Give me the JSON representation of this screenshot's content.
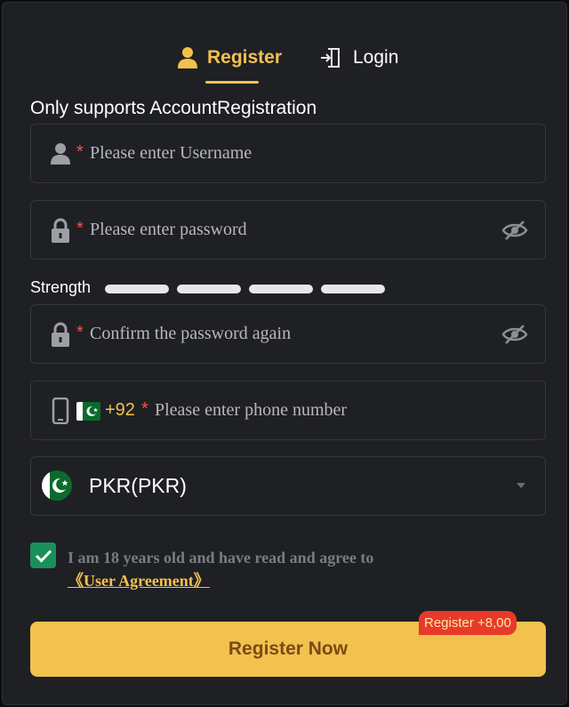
{
  "tabs": {
    "register": "Register",
    "login": "Login"
  },
  "subtitle": "Only supports AccountRegistration",
  "username": {
    "required": "*",
    "placeholder": "Please enter Username"
  },
  "password": {
    "required": "*",
    "placeholder": "Please enter password"
  },
  "strength": {
    "label": "Strength",
    "levels_filled": 0,
    "levels_total": 4
  },
  "confirm": {
    "required": "*",
    "placeholder": "Confirm the password again"
  },
  "phone": {
    "code": "+92",
    "required": "*",
    "placeholder": "Please enter phone number"
  },
  "currency": {
    "value": "PKR(PKR)"
  },
  "agreement": {
    "checked": true,
    "text": "I am 18 years old and have read and agree to ",
    "link": "《User Agreement》"
  },
  "submit": {
    "label": "Register Now",
    "bonus": "Register +8,00"
  },
  "icons": [
    "user-icon",
    "login-door-icon",
    "lock-icon",
    "eye-off-icon",
    "phone-icon",
    "pakistan-flag-icon",
    "chevron-down-icon",
    "check-icon"
  ],
  "colors": {
    "accent": "#f2c14e",
    "panel": "#1f2024",
    "required": "#ff4d4f",
    "checkbox": "#1a8f5a",
    "bonus": "#e83a2a"
  }
}
